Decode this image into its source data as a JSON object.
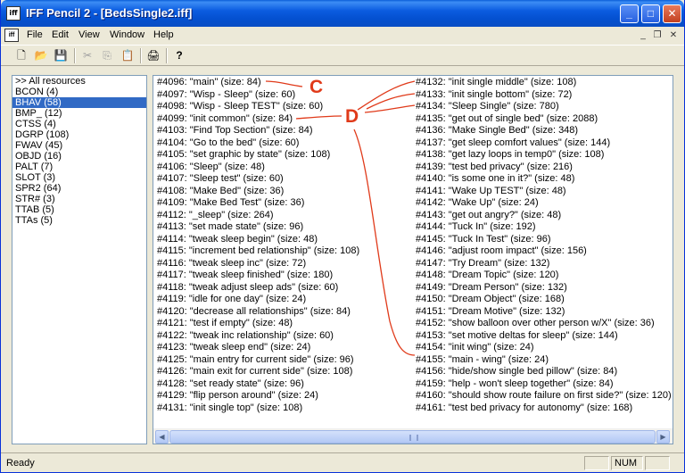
{
  "window": {
    "app_icon_text": "iff",
    "title": "IFF Pencil 2 - [BedsSingle2.iff]",
    "minimize_glyph": "_",
    "maximize_glyph": "□",
    "close_glyph": "✕"
  },
  "menubar": {
    "items": [
      "File",
      "Edit",
      "View",
      "Window",
      "Help"
    ],
    "mdi_minimize_glyph": "_",
    "mdi_restore_glyph": "❐",
    "mdi_close_glyph": "✕"
  },
  "toolbar": {
    "icons": [
      "new-file-icon",
      "open-folder-icon",
      "save-icon",
      "cut-icon",
      "copy-icon",
      "paste-icon",
      "print-icon",
      "help-icon"
    ],
    "glyphs": {
      "new": "🗋",
      "open": "📂",
      "save": "💾",
      "cut": "✂",
      "copy": "⎘",
      "paste": "📋",
      "print": "🖨",
      "help": "?"
    }
  },
  "resources": [
    ">> All resources",
    "BCON (4)",
    "BHAV (58)",
    "BMP_ (12)",
    "CTSS (4)",
    "DGRP (108)",
    "FWAV (45)",
    "OBJD (16)",
    "PALT (7)",
    "SLOT (3)",
    "SPR2 (64)",
    "STR# (3)",
    "TTAB (5)",
    "TTAs (5)"
  ],
  "selected_resource_index": 2,
  "list_left": [
    "#4096: \"main\" (size: 84)",
    "#4097: \"Wisp - Sleep\" (size: 60)",
    "#4098: \"Wisp - Sleep TEST\" (size: 60)",
    "#4099: \"init common\" (size: 84)",
    "#4103: \"Find Top Section\" (size: 84)",
    "#4104: \"Go to the bed\" (size: 60)",
    "#4105: \"set graphic by state\" (size: 108)",
    "#4106: \"Sleep\" (size: 48)",
    "#4107: \"Sleep test\" (size: 60)",
    "#4108: \"Make Bed\" (size: 36)",
    "#4109: \"Make Bed Test\" (size: 36)",
    "#4112: \"_sleep\" (size: 264)",
    "#4113: \"set made state\" (size: 96)",
    "#4114: \"tweak sleep begin\" (size: 48)",
    "#4115: \"increment bed relationship\" (size: 108)",
    "#4116: \"tweak sleep inc\" (size: 72)",
    "#4117: \"tweak sleep finished\" (size: 180)",
    "#4118: \"tweak adjust sleep ads\" (size: 60)",
    "#4119: \"idle for one day\" (size: 24)",
    "#4120: \"decrease all relationships\" (size: 84)",
    "#4121: \"test if empty\" (size: 48)",
    "#4122: \"tweak inc relationship\" (size: 60)",
    "#4123: \"tweak sleep end\" (size: 24)",
    "#4125: \"main entry for current side\" (size: 96)",
    "#4126: \"main exit for current side\" (size: 108)",
    "#4128: \"set ready state\" (size: 96)",
    "#4129: \"flip person around\" (size: 24)",
    "#4131: \"init single top\" (size: 108)"
  ],
  "list_right": [
    "#4132: \"init single middle\" (size: 108)",
    "#4133: \"init single bottom\" (size: 72)",
    "#4134: \"Sleep Single\" (size: 780)",
    "#4135: \"get out of single bed\" (size: 2088)",
    "#4136: \"Make Single Bed\" (size: 348)",
    "#4137: \"get sleep comfort values\" (size: 144)",
    "#4138: \"get lazy loops in temp0\" (size: 108)",
    "#4139: \"test bed privacy\" (size: 216)",
    "#4140: \"is some one in it?\" (size: 48)",
    "#4141: \"Wake Up TEST\" (size: 48)",
    "#4142: \"Wake Up\" (size: 24)",
    "#4143: \"get out angry?\" (size: 48)",
    "#4144: \"Tuck In\" (size: 192)",
    "#4145: \"Tuck In Test\" (size: 96)",
    "#4146: \"adjust room impact\" (size: 156)",
    "#4147: \"Try Dream\" (size: 132)",
    "#4148: \"Dream Topic\" (size: 120)",
    "#4149: \"Dream Person\" (size: 132)",
    "#4150: \"Dream Object\" (size: 168)",
    "#4151: \"Dream Motive\" (size: 132)",
    "#4152: \"show balloon over other person w/X\" (size: 36)",
    "#4153: \"set motive deltas for sleep\" (size: 144)",
    "#4154: \"init wing\" (size: 24)",
    "#4155: \"main - wing\" (size: 24)",
    "#4156: \"hide/show single bed pillow\" (size: 84)",
    "#4159: \"help - won't sleep together\" (size: 84)",
    "#4160: \"should show route failure on first side?\" (size: 120)",
    "#4161: \"test bed privacy for autonomy\" (size: 168)"
  ],
  "annotations": {
    "c_label": "C",
    "d_label": "D",
    "color": "#e03a1a"
  },
  "statusbar": {
    "text": "Ready",
    "num": "NUM"
  }
}
